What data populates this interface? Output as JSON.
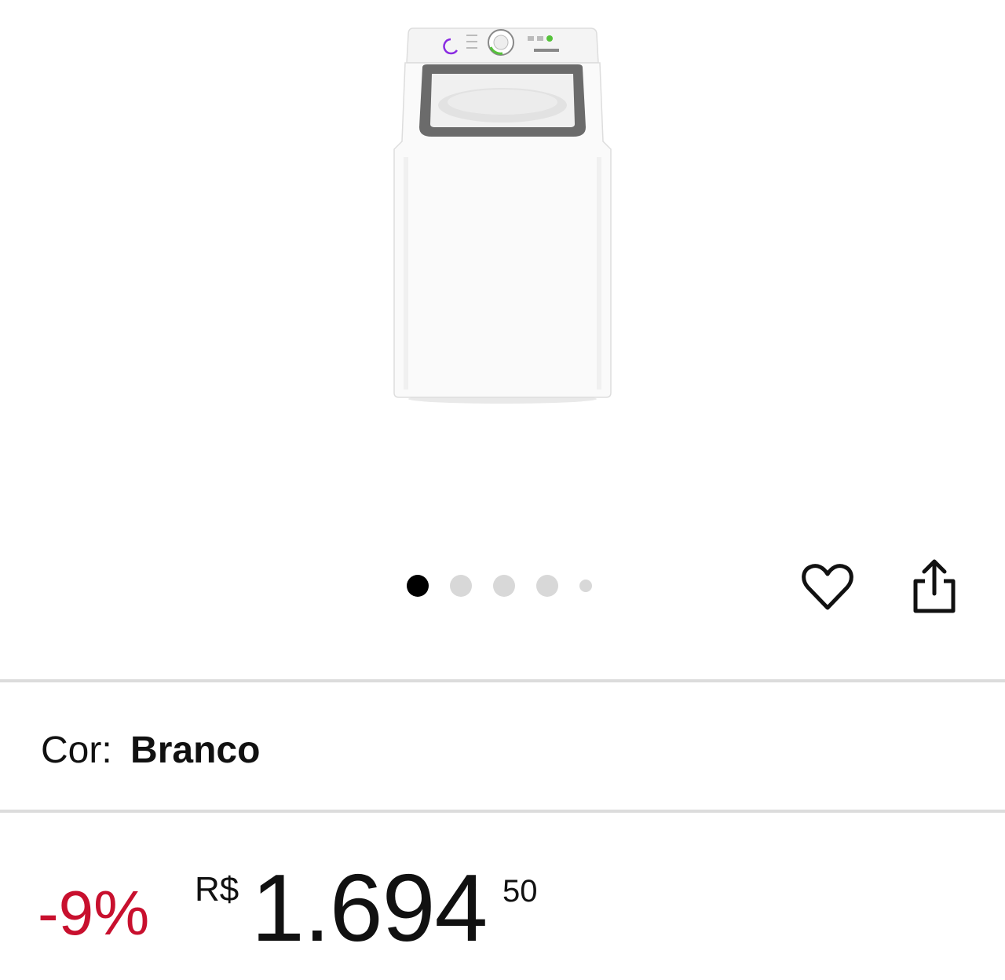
{
  "gallery": {
    "image_description": "washing-machine-product-photo",
    "slide_count": 5,
    "active_slide": 1
  },
  "actions": {
    "favorite_icon": "heart-icon",
    "share_icon": "share-icon"
  },
  "variant": {
    "label": "Cor:",
    "value": "Branco"
  },
  "price": {
    "discount": "-9%",
    "currency": "R$",
    "integer": "1.694",
    "cents": "50"
  },
  "colors": {
    "discount": "#c8102e",
    "dot_active": "#000000",
    "dot_inactive": "#d8d8d8",
    "divider": "#dcdcdc"
  }
}
